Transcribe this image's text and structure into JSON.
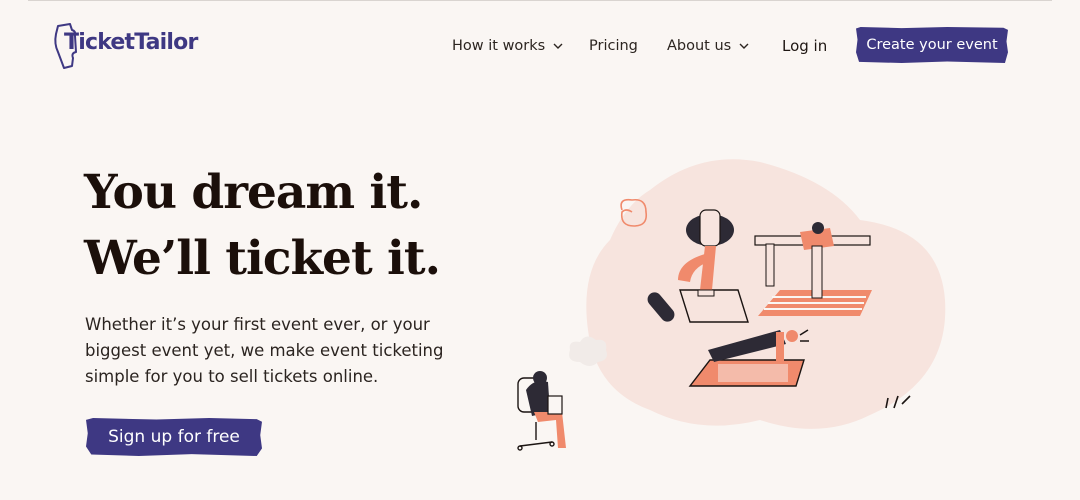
{
  "header": {
    "logo_text": "TicketTailor",
    "nav": {
      "how_it_works": "How it works",
      "pricing": "Pricing",
      "about_us": "About us",
      "log_in": "Log in"
    },
    "cta": "Create your event"
  },
  "hero": {
    "headline_line1": "You dream it.",
    "headline_line2": "We’ll ticket it.",
    "subtext": "Whether it’s your first event ever, or your biggest event yet, we make event ticketing simple for you to sell tickets online.",
    "cta": "Sign up for free"
  },
  "colors": {
    "brand": "#3e3883",
    "background": "#faf6f3",
    "accent": "#f08a6c",
    "blob": "#f7e4de"
  },
  "icons": {
    "logo": "ticket-logo-icon",
    "dropdown": "chevron-down-icon"
  }
}
